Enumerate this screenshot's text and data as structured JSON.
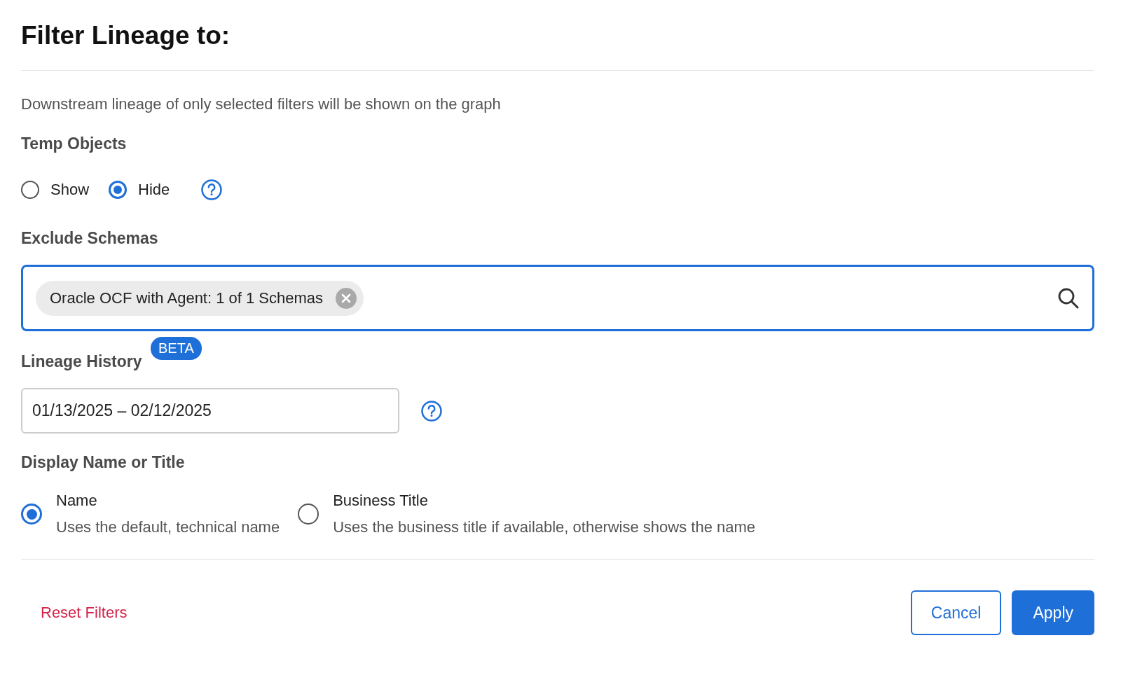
{
  "title": "Filter Lineage to:",
  "description": "Downstream lineage of only selected filters will be shown on the graph",
  "temp_objects": {
    "label": "Temp Objects",
    "options": [
      {
        "label": "Show",
        "selected": false
      },
      {
        "label": "Hide",
        "selected": true
      }
    ]
  },
  "exclude_schemas": {
    "label": "Exclude Schemas",
    "chips": [
      "Oracle OCF with Agent: 1 of 1 Schemas"
    ]
  },
  "lineage_history": {
    "label": "Lineage History",
    "badge": "BETA",
    "value": "01/13/2025 – 02/12/2025"
  },
  "display": {
    "label": "Display Name or Title",
    "options": [
      {
        "label": "Name",
        "description": "Uses the default, technical name",
        "selected": true
      },
      {
        "label": "Business Title",
        "description": "Uses the business title if available, otherwise shows the name",
        "selected": false
      }
    ]
  },
  "footer": {
    "reset": "Reset Filters",
    "buttons": [
      {
        "label": "Cancel",
        "kind": "secondary"
      },
      {
        "label": "Apply",
        "kind": "primary"
      }
    ]
  }
}
